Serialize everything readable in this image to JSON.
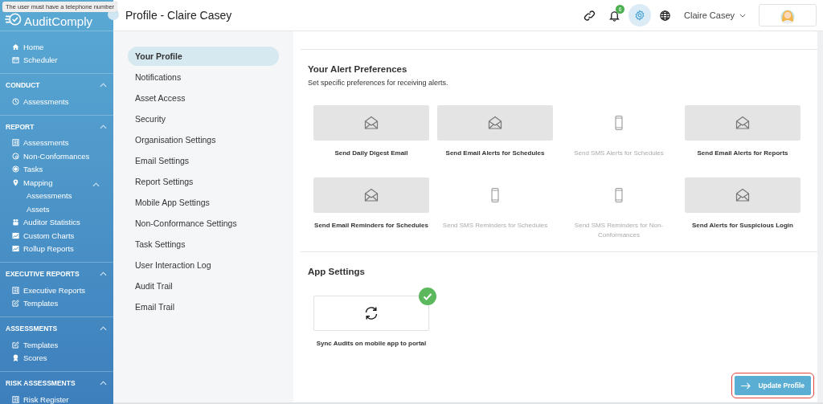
{
  "tooltip": "The user must have a telephone number",
  "brand": "AuditComply",
  "sidebar": {
    "top_items": [
      {
        "label": "Home"
      },
      {
        "label": "Scheduler"
      }
    ],
    "sections": [
      {
        "title": "CONDUCT",
        "expanded": true,
        "items": [
          {
            "label": "Assessments"
          }
        ]
      },
      {
        "title": "REPORT",
        "expanded": true,
        "items": [
          {
            "label": "Assessments"
          },
          {
            "label": "Non-Conformances"
          },
          {
            "label": "Tasks"
          },
          {
            "label": "Mapping",
            "expanded": true,
            "children": [
              {
                "label": "Assessments"
              },
              {
                "label": "Assets"
              }
            ]
          },
          {
            "label": "Auditor Statistics"
          },
          {
            "label": "Custom Charts"
          },
          {
            "label": "Rollup Reports"
          }
        ]
      },
      {
        "title": "EXECUTIVE REPORTS",
        "expanded": true,
        "items": [
          {
            "label": "Executive Reports"
          },
          {
            "label": "Templates"
          }
        ]
      },
      {
        "title": "ASSESSMENTS",
        "expanded": true,
        "items": [
          {
            "label": "Templates"
          },
          {
            "label": "Scores"
          }
        ]
      },
      {
        "title": "RISK ASSESSMENTS",
        "expanded": true,
        "items": [
          {
            "label": "Risk Register"
          }
        ]
      }
    ]
  },
  "header": {
    "title": "Profile - Claire Casey",
    "notification_count": "6",
    "user_name": "Claire Casey"
  },
  "settings_nav": [
    {
      "label": "Your Profile",
      "selected": true
    },
    {
      "label": "Notifications",
      "selected": false
    },
    {
      "label": "Asset Access",
      "selected": false
    },
    {
      "label": "Security",
      "selected": false
    },
    {
      "label": "Organisation Settings",
      "selected": false
    },
    {
      "label": "Email Settings",
      "selected": false
    },
    {
      "label": "Report Settings",
      "selected": false
    },
    {
      "label": "Mobile App Settings",
      "selected": false
    },
    {
      "label": "Non-Conformance Settings",
      "selected": false
    },
    {
      "label": "Task Settings",
      "selected": false
    },
    {
      "label": "User Interaction Log",
      "selected": false
    },
    {
      "label": "Audit Trail",
      "selected": false
    },
    {
      "label": "Email Trail",
      "selected": false
    }
  ],
  "alerts": {
    "title": "Your Alert Preferences",
    "subtitle": "Set specific preferences for receiving alerts.",
    "options": [
      {
        "label": "Send Daily Digest Email",
        "kind": "email",
        "on": true
      },
      {
        "label": "Send Email Alerts for Schedules",
        "kind": "email",
        "on": true
      },
      {
        "label": "Send SMS Alerts for Schedules",
        "kind": "sms",
        "on": false
      },
      {
        "label": "Send Email Alerts for Reports",
        "kind": "email",
        "on": true
      },
      {
        "label": "Send Email Reminders for Schedules",
        "kind": "email",
        "on": true
      },
      {
        "label": "Send SMS Reminders for Schedules",
        "kind": "sms",
        "on": false
      },
      {
        "label": "Send SMS Reminders for Non-Conformances",
        "kind": "sms",
        "on": false
      },
      {
        "label": "Send Alerts for Suspicious Login",
        "kind": "email",
        "on": true
      }
    ]
  },
  "app_settings": {
    "title": "App Settings",
    "options": [
      {
        "label": "Sync Audits on mobile app to portal",
        "checked": true
      }
    ]
  },
  "update_button": {
    "label": "Update Profile",
    "highlighted": true
  }
}
